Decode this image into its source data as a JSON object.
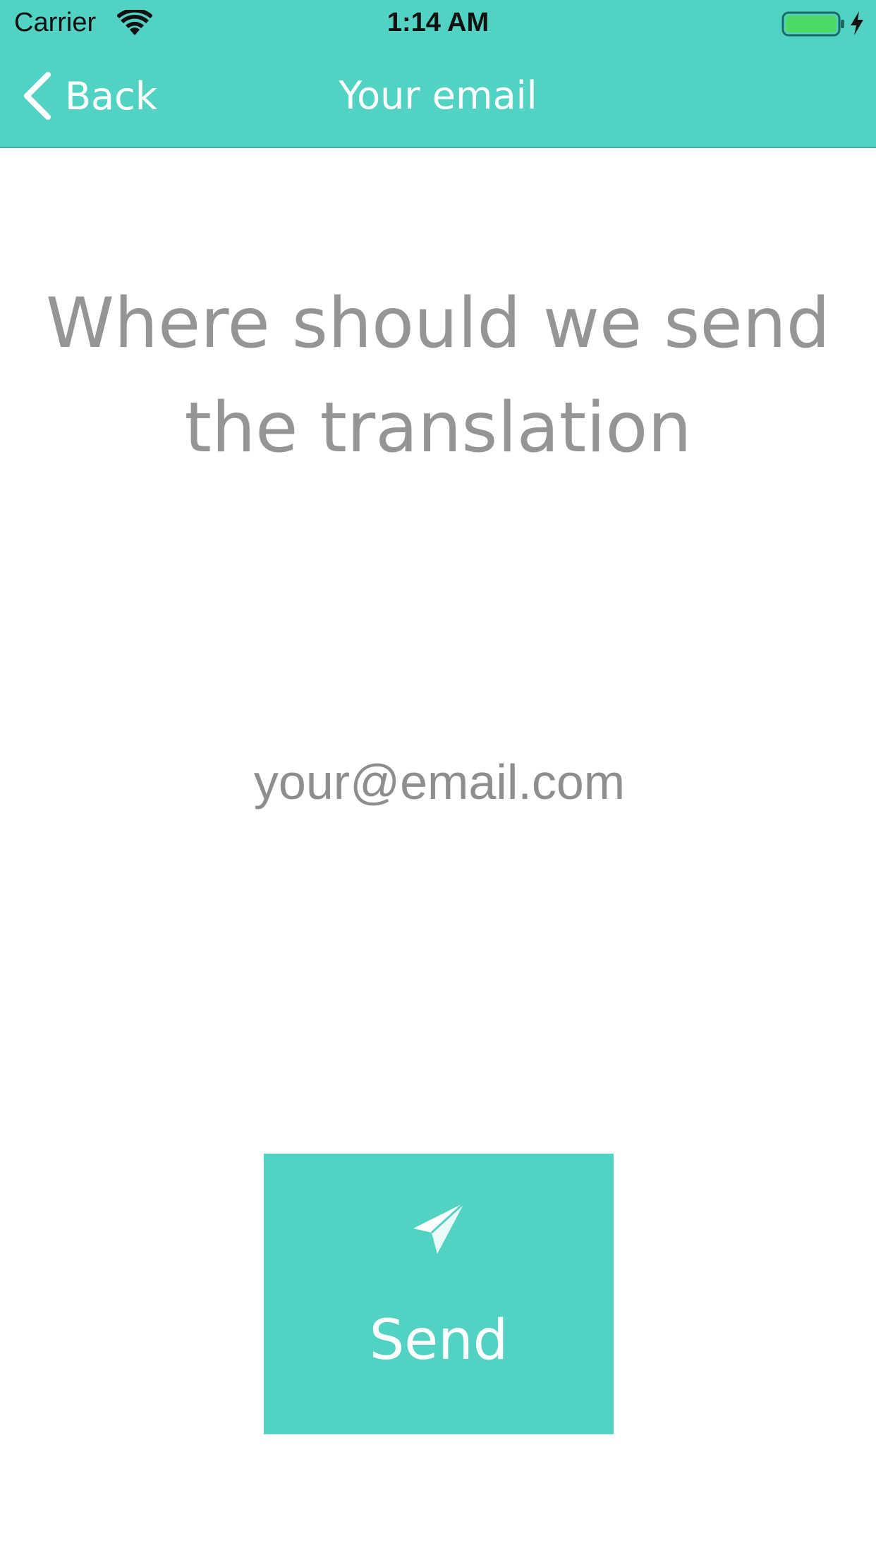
{
  "status_bar": {
    "carrier": "Carrier",
    "time": "1:14 AM",
    "wifi_icon": "wifi-icon",
    "battery_icon": "battery-full-icon",
    "charging_icon": "charging-bolt-icon",
    "battery_level": 1.0
  },
  "nav_bar": {
    "back_label": "Back",
    "title": "Your email",
    "back_icon": "chevron-left-icon"
  },
  "main": {
    "prompt": "Where should we send the translation",
    "email_value": "",
    "email_placeholder": "your@email.com"
  },
  "send_button": {
    "label": "Send",
    "icon": "paper-plane-icon"
  },
  "colors": {
    "accent": "#51d2c2",
    "text_gray": "#959595",
    "battery_green": "#4cd964",
    "white": "#ffffff"
  }
}
